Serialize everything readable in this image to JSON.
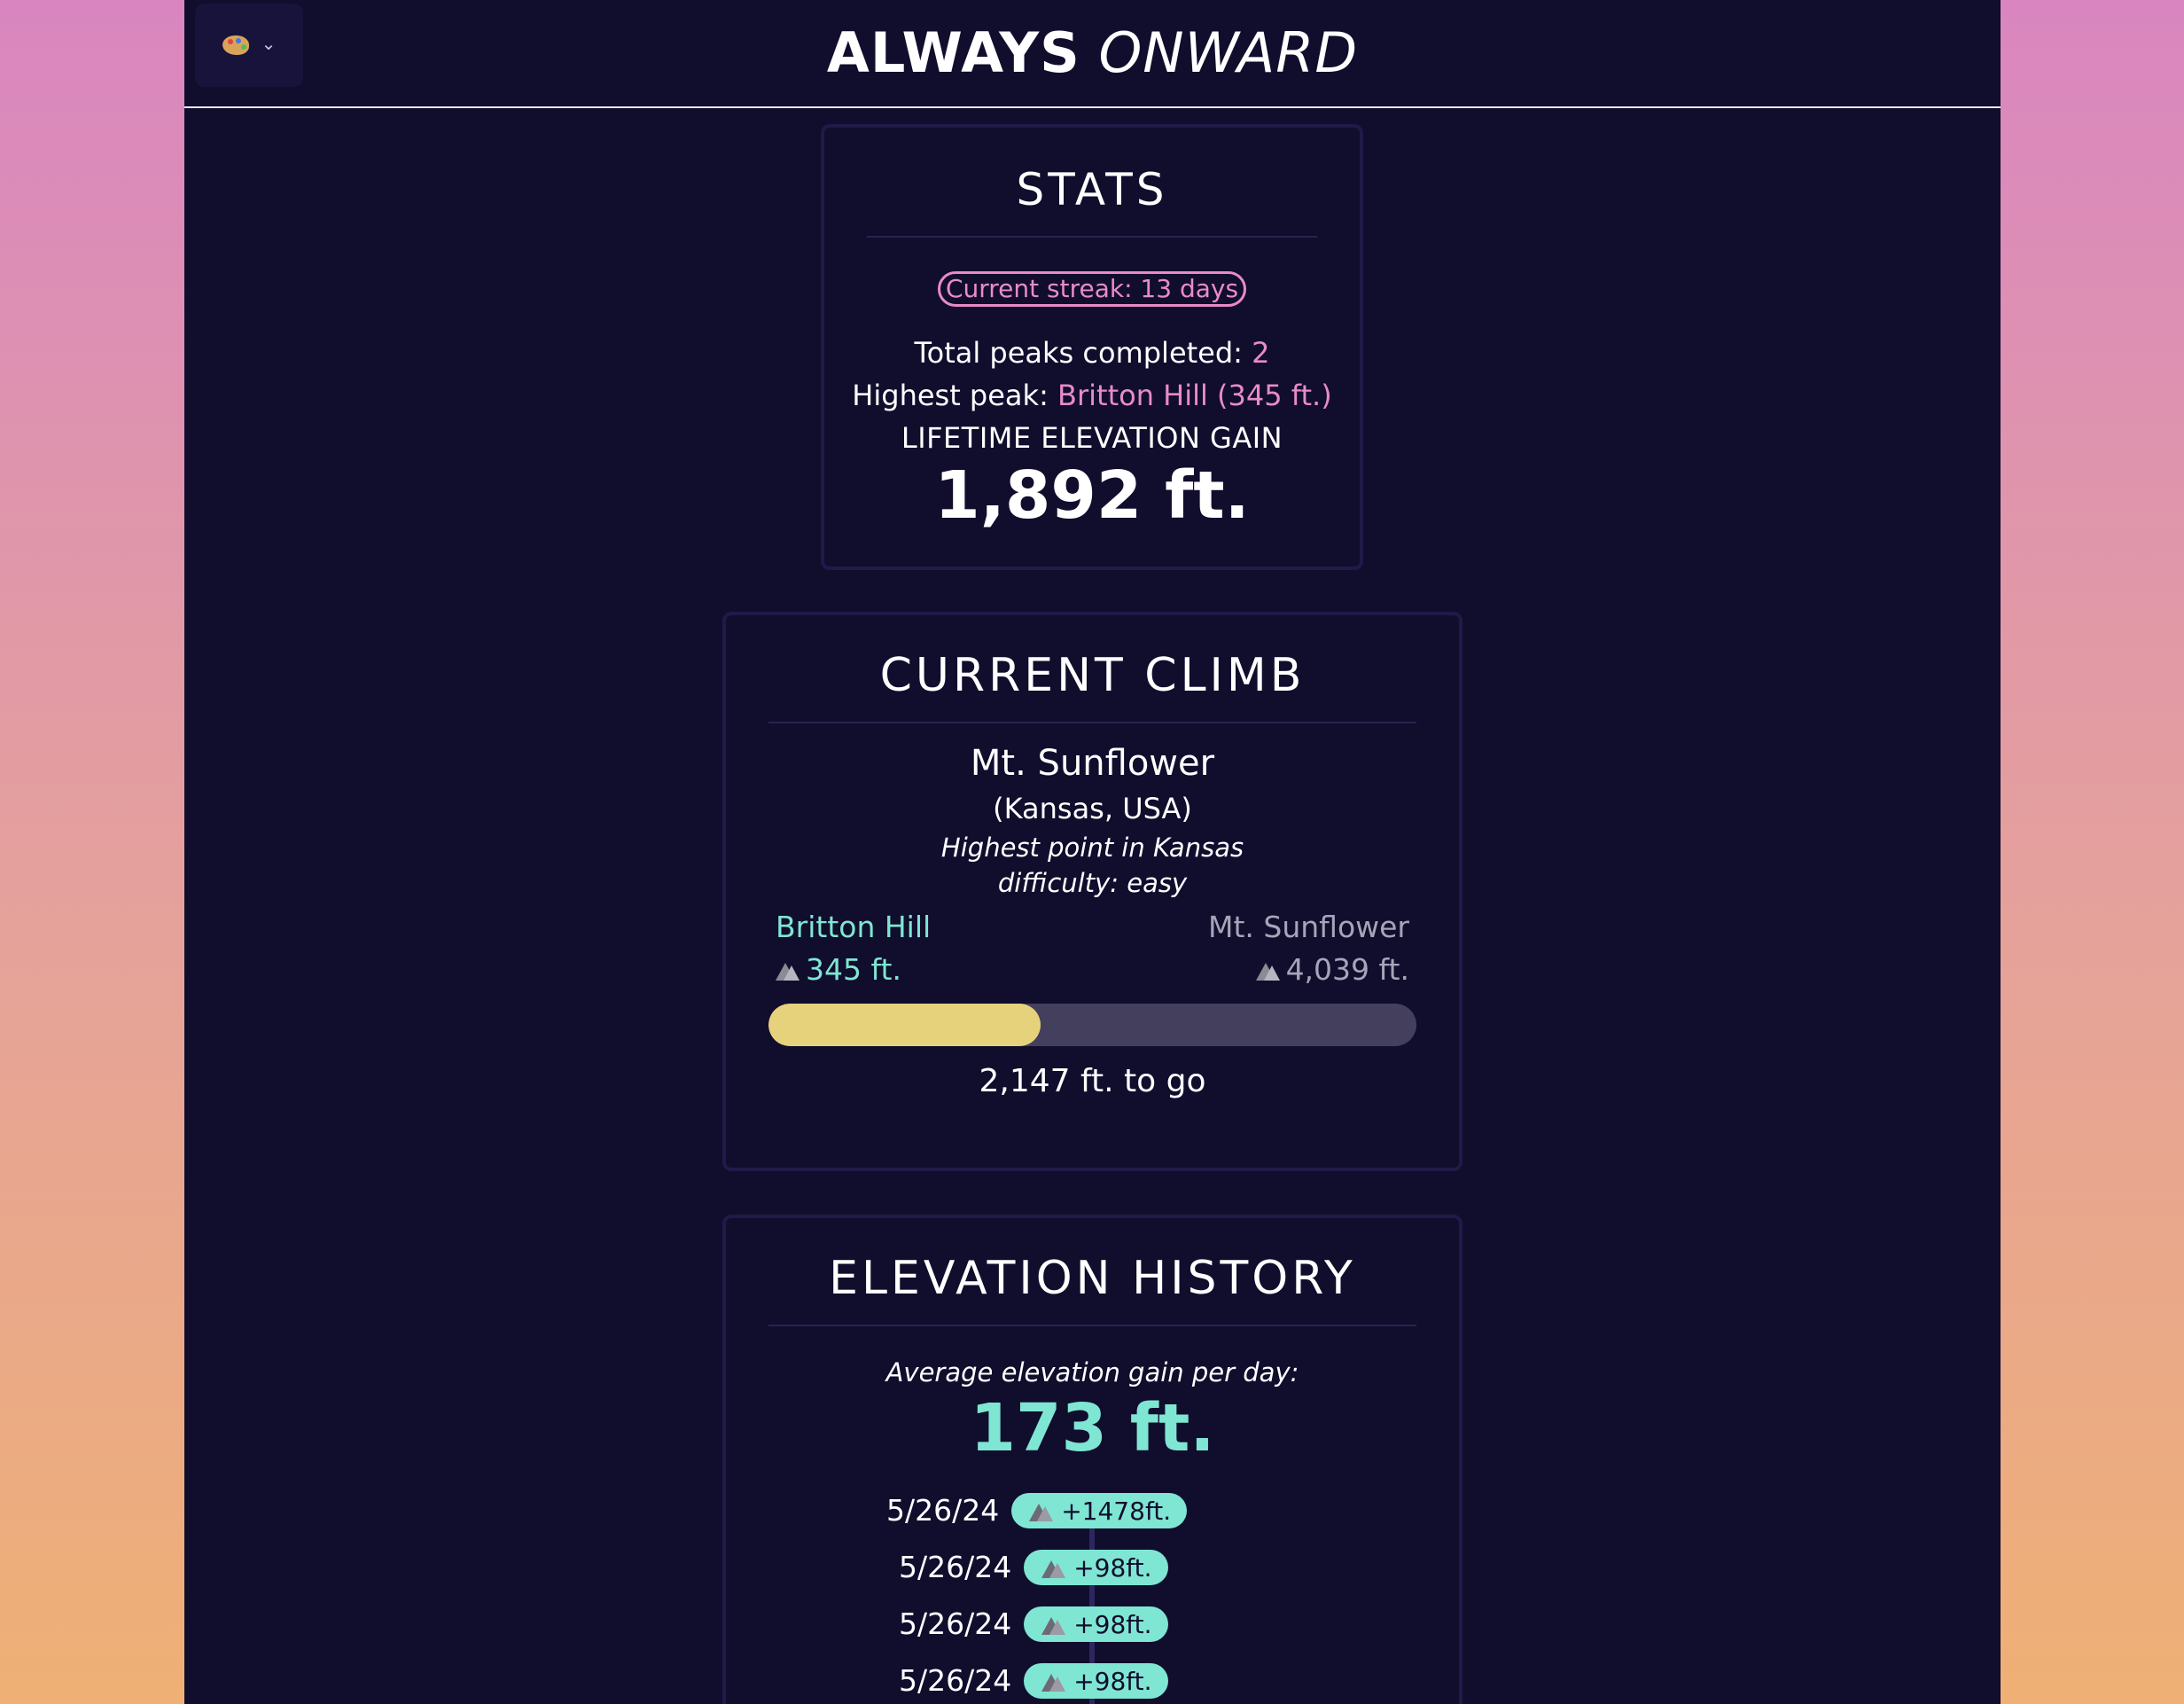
{
  "header": {
    "brand_bold": "ALWAYS",
    "brand_italic": "ONWARD",
    "theme_icon": "palette-icon",
    "theme_chevron": "⌄"
  },
  "stats": {
    "title": "STATS",
    "streak": "Current streak: 13 days",
    "total_label": "Total peaks completed: ",
    "total_value": "2",
    "highest_label": "Highest peak: ",
    "highest_value": "Britton Hill (345 ft.)",
    "lifetime_label": "LIFETIME ELEVATION GAIN",
    "lifetime_value": "1,892 ft."
  },
  "current_climb": {
    "title": "CURRENT CLIMB",
    "peak_name": "Mt. Sunflower",
    "location": "(Kansas, USA)",
    "note": "Highest point in Kansas",
    "difficulty": "difficulty: easy",
    "from": {
      "name": "Britton Hill",
      "elevation": "345 ft."
    },
    "to": {
      "name": "Mt. Sunflower",
      "elevation": "4,039 ft."
    },
    "progress_fraction": 0.42,
    "to_go": "2,147 ft. to go"
  },
  "history": {
    "title": "ELEVATION HISTORY",
    "avg_label": "Average elevation gain per day:",
    "avg_value": "173 ft.",
    "entries": [
      {
        "date": "5/26/24",
        "gain": "+1478ft."
      },
      {
        "date": "5/26/24",
        "gain": "+98ft."
      },
      {
        "date": "5/26/24",
        "gain": "+98ft."
      },
      {
        "date": "5/26/24",
        "gain": "+98ft."
      }
    ]
  },
  "colors": {
    "background_panel": "#110d2d",
    "accent_pink": "#e88bc9",
    "accent_teal": "#7fe6d3",
    "progress_fill": "#e7d27c",
    "progress_track": "#433f5c"
  }
}
